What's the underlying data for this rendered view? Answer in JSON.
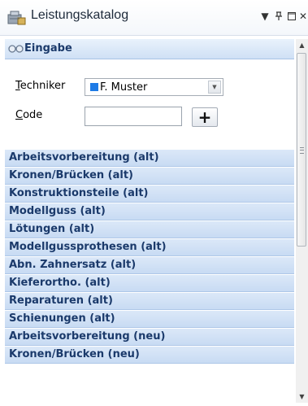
{
  "window": {
    "title": "Leistungskatalog",
    "controls": [
      "dropdown-icon",
      "pin-icon",
      "maximize-icon",
      "close-icon"
    ]
  },
  "section": {
    "title": "Eingabe",
    "icon": "glasses-icon"
  },
  "form": {
    "techniker_label": {
      "accel": "T",
      "rest": "echniker"
    },
    "techniker_value": "F. Muster",
    "techniker_swatch_color": "#1e7be6",
    "code_label": {
      "accel": "C",
      "rest": "ode"
    },
    "code_value": "",
    "add_label": "+"
  },
  "categories": [
    "Arbeitsvorbereitung (alt)",
    "Kronen/Brücken (alt)",
    "Konstruktionsteile (alt)",
    "Modellguss (alt)",
    "Lötungen (alt)",
    "Modellgussprothesen (alt)",
    "Abn. Zahnersatz (alt)",
    "Kieferortho. (alt)",
    "Reparaturen (alt)",
    "Schienungen (alt)",
    "Arbeitsvorbereitung (neu)",
    "Kronen/Brücken (neu)"
  ],
  "colors": {
    "header_text": "#1b3a6b",
    "category_bg": "#c8dbf3",
    "accent": "#1e7be6"
  }
}
